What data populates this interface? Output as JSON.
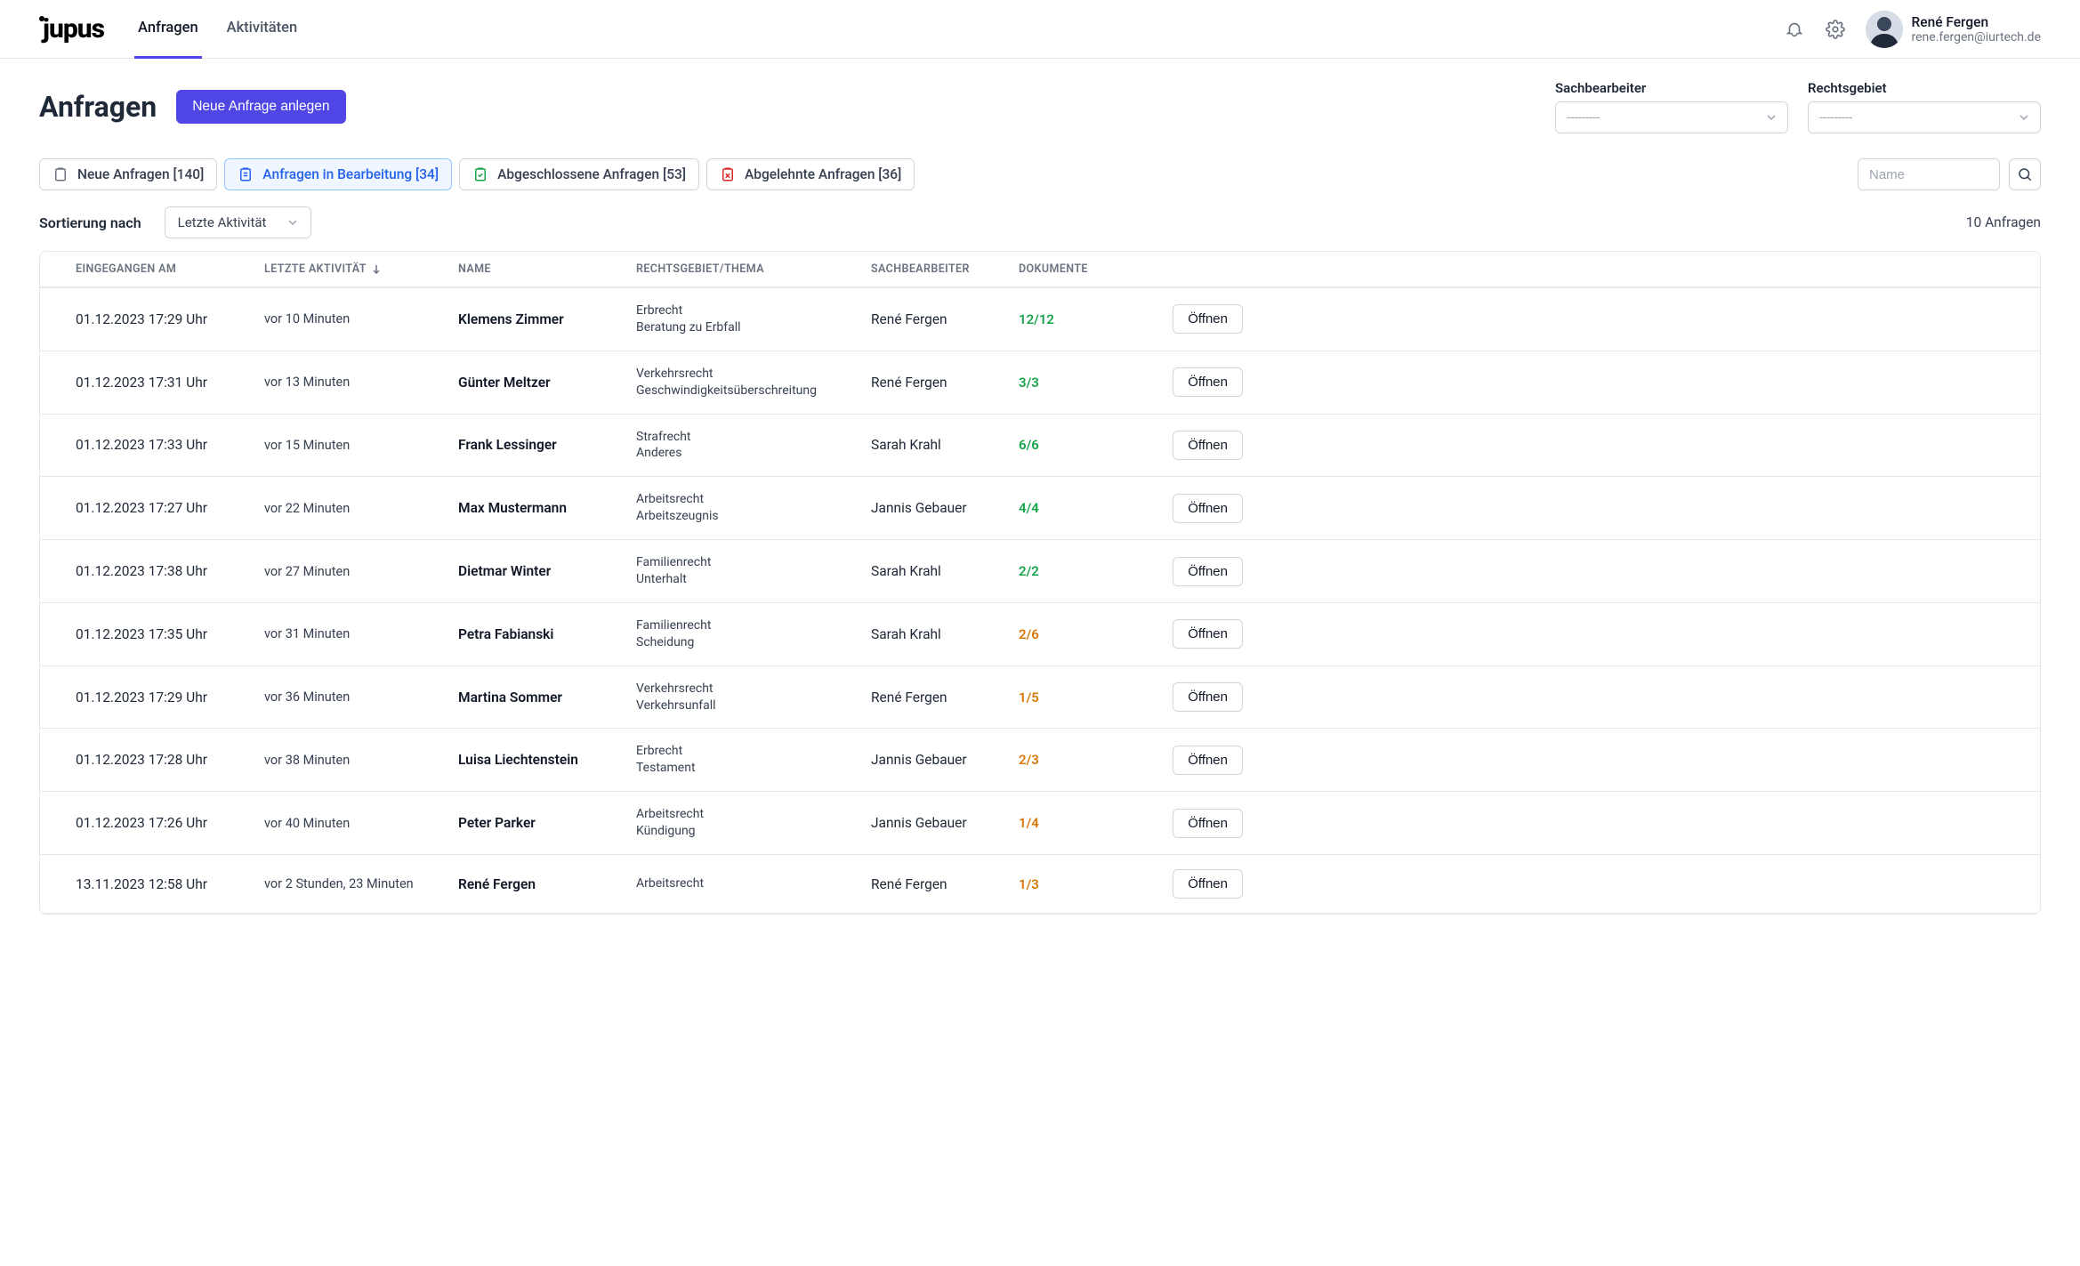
{
  "app": {
    "logo": "jupus"
  },
  "nav": {
    "tabs": [
      "Anfragen",
      "Aktivitäten"
    ],
    "active_index": 0
  },
  "user": {
    "name": "René Fergen",
    "email": "rene.fergen@iurtech.de"
  },
  "page": {
    "title": "Anfragen",
    "new_button": "Neue Anfrage anlegen"
  },
  "filters": {
    "agent": {
      "label": "Sachbearbeiter",
      "placeholder": "---------"
    },
    "area": {
      "label": "Rechtsgebiet",
      "placeholder": "---------"
    }
  },
  "status_tabs": [
    {
      "label": "Neue Anfragen",
      "count": "[140]",
      "color": "grey",
      "active": false
    },
    {
      "label": "Anfragen in Bearbeitung",
      "count": "[34]",
      "color": "blue",
      "active": true
    },
    {
      "label": "Abgeschlossene Anfragen",
      "count": "[53]",
      "color": "green",
      "active": false
    },
    {
      "label": "Abgelehnte Anfragen",
      "count": "[36]",
      "color": "red",
      "active": false
    }
  ],
  "search": {
    "placeholder": "Name"
  },
  "sort": {
    "label": "Sortierung nach",
    "selected": "Letzte Aktivität"
  },
  "result_count": "10 Anfragen",
  "columns": {
    "date": "Eingegangen am",
    "activity": "Letzte Aktivität",
    "name": "Name",
    "topic": "Rechtsgebiet/Thema",
    "agent": "Sachbearbeiter",
    "docs": "Dokumente"
  },
  "open_label": "Öffnen",
  "rows": [
    {
      "date": "01.12.2023 17:29 Uhr",
      "activity": "vor 10 Minuten",
      "name": "Klemens Zimmer",
      "area": "Erbrecht",
      "sub": "Beratung zu Erbfall",
      "agent": "René Fergen",
      "docs": "12/12",
      "docs_state": "green"
    },
    {
      "date": "01.12.2023 17:31 Uhr",
      "activity": "vor 13 Minuten",
      "name": "Günter Meltzer",
      "area": "Verkehrsrecht",
      "sub": "Geschwindigkeitsüberschreitung",
      "agent": "René Fergen",
      "docs": "3/3",
      "docs_state": "green"
    },
    {
      "date": "01.12.2023 17:33 Uhr",
      "activity": "vor 15 Minuten",
      "name": "Frank Lessinger",
      "area": "Strafrecht",
      "sub": "Anderes",
      "agent": "Sarah Krahl",
      "docs": "6/6",
      "docs_state": "green"
    },
    {
      "date": "01.12.2023 17:27 Uhr",
      "activity": "vor 22 Minuten",
      "name": "Max Mustermann",
      "area": "Arbeitsrecht",
      "sub": "Arbeitszeugnis",
      "agent": "Jannis Gebauer",
      "docs": "4/4",
      "docs_state": "green"
    },
    {
      "date": "01.12.2023 17:38 Uhr",
      "activity": "vor 27 Minuten",
      "name": "Dietmar Winter",
      "area": "Familienrecht",
      "sub": "Unterhalt",
      "agent": "Sarah Krahl",
      "docs": "2/2",
      "docs_state": "green"
    },
    {
      "date": "01.12.2023 17:35 Uhr",
      "activity": "vor 31 Minuten",
      "name": "Petra Fabianski",
      "area": "Familienrecht",
      "sub": "Scheidung",
      "agent": "Sarah Krahl",
      "docs": "2/6",
      "docs_state": "amber"
    },
    {
      "date": "01.12.2023 17:29 Uhr",
      "activity": "vor 36 Minuten",
      "name": "Martina Sommer",
      "area": "Verkehrsrecht",
      "sub": "Verkehrsunfall",
      "agent": "René Fergen",
      "docs": "1/5",
      "docs_state": "amber"
    },
    {
      "date": "01.12.2023 17:28 Uhr",
      "activity": "vor 38 Minuten",
      "name": "Luisa Liechtenstein",
      "area": "Erbrecht",
      "sub": "Testament",
      "agent": "Jannis Gebauer",
      "docs": "2/3",
      "docs_state": "amber"
    },
    {
      "date": "01.12.2023 17:26 Uhr",
      "activity": "vor 40 Minuten",
      "name": "Peter Parker",
      "area": "Arbeitsrecht",
      "sub": "Kündigung",
      "agent": "Jannis Gebauer",
      "docs": "1/4",
      "docs_state": "amber"
    },
    {
      "date": "13.11.2023 12:58 Uhr",
      "activity": "vor 2 Stunden, 23 Minuten",
      "name": "René Fergen",
      "area": "Arbeitsrecht",
      "sub": "",
      "agent": "René Fergen",
      "docs": "1/3",
      "docs_state": "amber"
    }
  ]
}
